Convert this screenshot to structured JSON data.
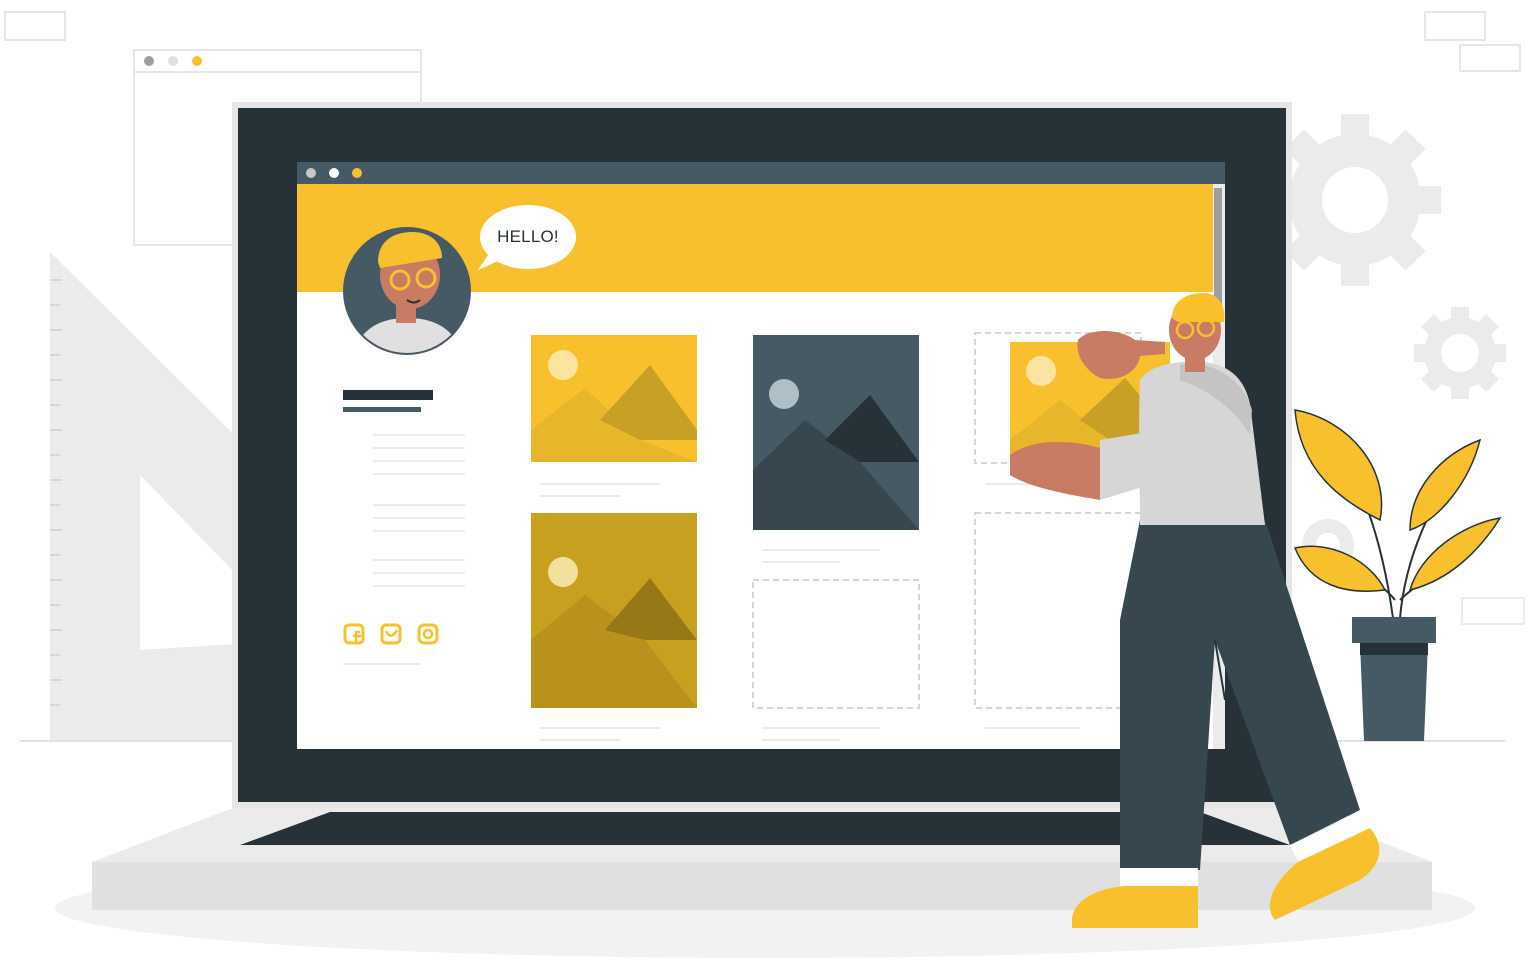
{
  "speech_bubble": {
    "text": "HELLO!"
  },
  "colors": {
    "accent": "#F9C02D",
    "accent_dark": "#C8A01F",
    "dark": "#263238",
    "slate": "#455A64",
    "light_gray": "#EBEBEB"
  },
  "social_icons": [
    {
      "icon": "facebook-icon"
    },
    {
      "icon": "twitter-icon"
    },
    {
      "icon": "instagram-icon"
    }
  ]
}
